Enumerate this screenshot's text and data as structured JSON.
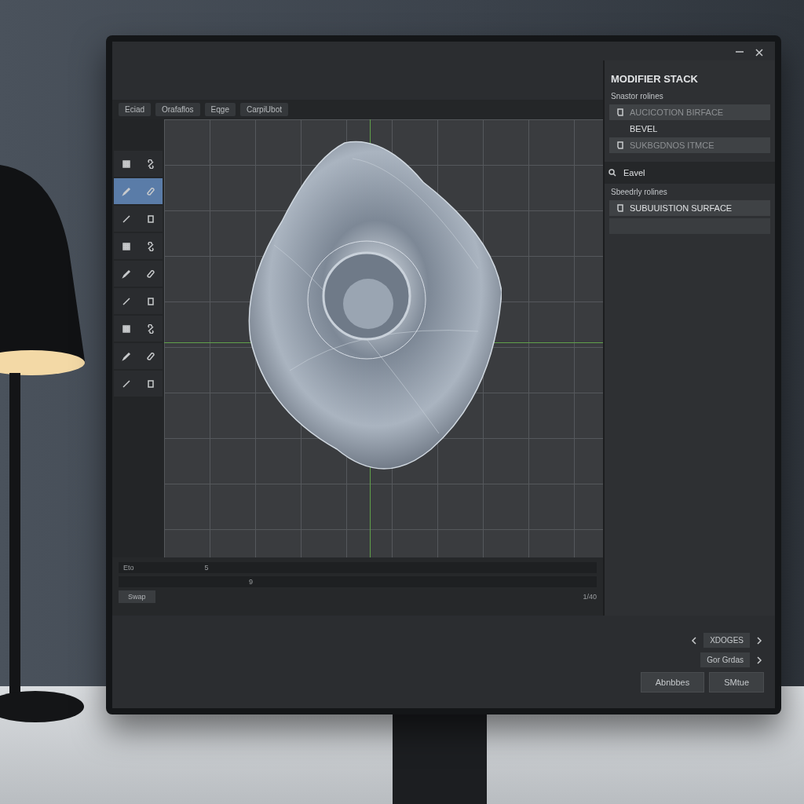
{
  "menu_bar": {
    "items": [
      "Eciad",
      "Orafaflos",
      "Eqge",
      "CarpiUbot"
    ]
  },
  "tool_panel": {
    "rows": [
      {
        "selected": false
      },
      {
        "selected": true
      },
      {
        "selected": false
      },
      {
        "selected": false
      },
      {
        "selected": false
      },
      {
        "selected": false
      },
      {
        "selected": false
      },
      {
        "selected": false
      },
      {
        "selected": false
      }
    ]
  },
  "timeline": {
    "rows": [
      {
        "label": "Eto",
        "marker": "5"
      },
      {
        "marker": "9"
      }
    ],
    "frame": "1/40",
    "button": "Swap"
  },
  "modifier_panel": {
    "title": "MODIFIER STACK",
    "groups": [
      {
        "label": "Snastor rolines",
        "items": [
          {
            "label": "AUCICOTION BIRFACE",
            "kind": "icon",
            "disabled": true
          },
          {
            "label": "BEVEL",
            "kind": "plain",
            "disabled": false
          },
          {
            "label": "SUKBGDNOS ITMCE",
            "kind": "icon",
            "disabled": true
          }
        ]
      },
      {
        "heading": "Eavel",
        "label": "Sbeedrly rolines",
        "items": [
          {
            "label": "SUBUUISTION SURFACE",
            "kind": "icon",
            "disabled": false
          },
          {
            "kind": "empty"
          }
        ]
      }
    ]
  },
  "bottom_bar": {
    "stepper": "XDOGES",
    "option": "Gor Grdas",
    "buttons": [
      "Abnbbes",
      "SMtue"
    ]
  }
}
